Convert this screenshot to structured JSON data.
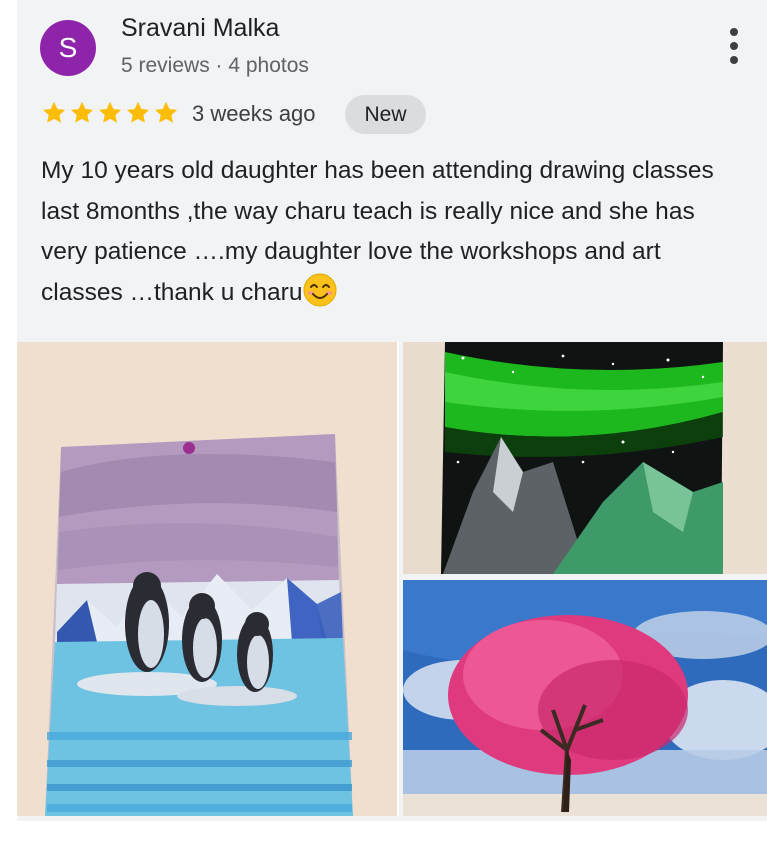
{
  "review": {
    "avatar_letter": "S",
    "avatar_color": "#8e24aa",
    "author_name": "Sravani Malka",
    "author_meta": "5 reviews · 4 photos",
    "rating": 5,
    "star_color": "#fbbc04",
    "time": "3 weeks ago",
    "badge": "New",
    "text": "My 10 years old daughter has been attending drawing classes last 8months ,the way charu teach is really nice and she has very patience ….my daughter love the workshops and art classes …thank u charu",
    "text_emoji": "smiling-face-emoji"
  },
  "photos": [
    {
      "icon": "penguin-painting"
    },
    {
      "icon": "aurora-mountain-painting"
    },
    {
      "icon": "pink-tree-painting"
    }
  ]
}
